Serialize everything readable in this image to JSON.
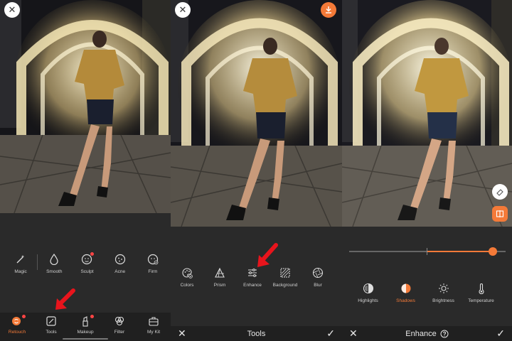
{
  "panel1": {
    "tools": [
      {
        "label": "Magic",
        "icon": "magic-wand-icon"
      },
      {
        "label": "Smooth",
        "icon": "droplet-icon"
      },
      {
        "label": "Sculpt",
        "icon": "face-icon"
      },
      {
        "label": "Acne",
        "icon": "acne-icon"
      },
      {
        "label": "Firm",
        "icon": "face-firm-icon"
      }
    ],
    "nav": [
      {
        "label": "Retouch",
        "icon": "retouch-icon",
        "active": true
      },
      {
        "label": "Tools",
        "icon": "tools-icon"
      },
      {
        "label": "Makeup",
        "icon": "lipstick-icon"
      },
      {
        "label": "Filter",
        "icon": "filter-icon"
      },
      {
        "label": "My Kit",
        "icon": "kit-icon"
      }
    ]
  },
  "panel2": {
    "tools": [
      {
        "label": "Colors",
        "icon": "palette-icon"
      },
      {
        "label": "Prism",
        "icon": "prism-icon"
      },
      {
        "label": "Enhance",
        "icon": "sliders-icon"
      },
      {
        "label": "Background",
        "icon": "background-icon"
      },
      {
        "label": "Blur",
        "icon": "aperture-icon"
      }
    ],
    "title": "Tools"
  },
  "panel3": {
    "tools": [
      {
        "label": "Highlights",
        "icon": "highlights-icon"
      },
      {
        "label": "Shadows",
        "icon": "shadows-icon",
        "active": true
      },
      {
        "label": "Brightness",
        "icon": "sun-icon"
      },
      {
        "label": "Temperature",
        "icon": "thermometer-icon"
      }
    ],
    "title": "Enhance",
    "slider_value": 0.92
  },
  "colors": {
    "accent": "#f47a38",
    "arrow": "#e8141c"
  }
}
